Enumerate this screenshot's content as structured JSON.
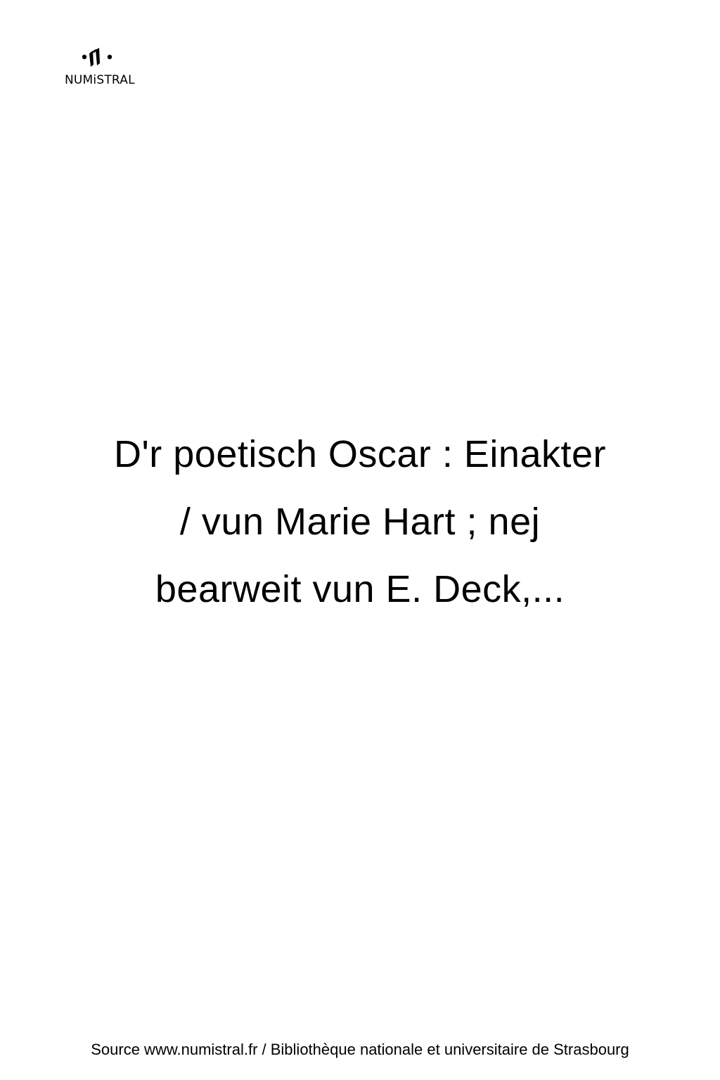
{
  "logo": {
    "icon": "numistral-logo-icon",
    "text": "NUMiSTRAL"
  },
  "title": {
    "lines": [
      "D'r poetisch Oscar : Einakter",
      "/ vun Marie Hart ; nej",
      "bearweit vun E. Deck,..."
    ]
  },
  "footer": {
    "source": "Source www.numistral.fr / Bibliothèque nationale et universitaire de Strasbourg"
  }
}
